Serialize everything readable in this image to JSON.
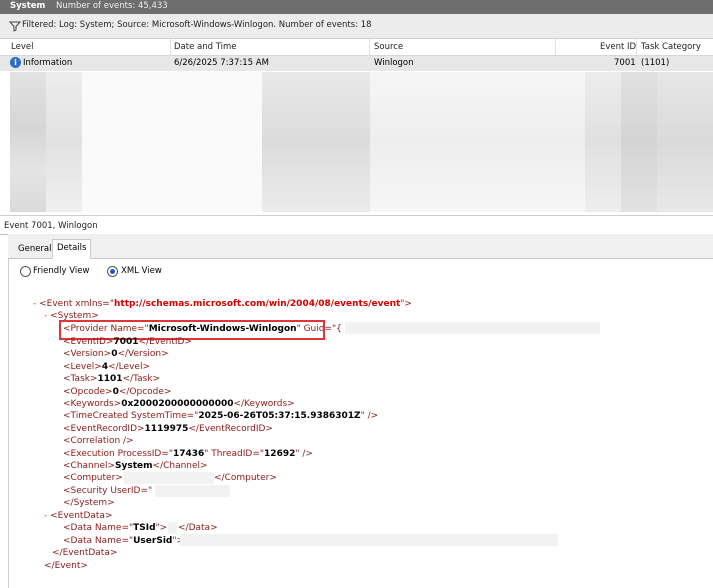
{
  "titlebar": {
    "log_name": "System",
    "event_count": "Number of events: 45,433"
  },
  "filter": {
    "text": "Filtered: Log: System; Source: Microsoft-Windows-Winlogon. Number of events: 18"
  },
  "grid": {
    "columns": [
      "Level",
      "Date and Time",
      "Source",
      "Event ID",
      "Task Category"
    ],
    "selected_row": {
      "level": "Information",
      "datetime": "6/26/2025 7:37:15 AM",
      "source": "Winlogon",
      "event_id": "7001",
      "task_category": "(1101)"
    }
  },
  "event_label": "Event 7001, Winlogon",
  "tabs": [
    "General",
    "Details"
  ],
  "view_options": {
    "friendly": "Friendly View",
    "xml": "XML View",
    "selected": "XML View"
  },
  "xml": {
    "event_open_pre": "<Event xmlns=\"",
    "event_ns": "http://schemas.microsoft.com/win/2004/08/events/event",
    "event_open_post": "\">",
    "system_open": "<System>",
    "provider_pre": "<Provider Name=\"",
    "provider_name": "Microsoft-Windows-Winlogon",
    "provider_post": "\" Guid=\"{",
    "eventid_open": "<EventID>",
    "eventid_val": "7001",
    "eventid_close": "</EventID>",
    "version_open": "<Version>",
    "version_val": "0",
    "version_close": "</Version>",
    "level_open": "<Level>",
    "level_val": "4",
    "level_close": "</Level>",
    "task_open": "<Task>",
    "task_val": "1101",
    "task_close": "</Task>",
    "opcode_open": "<Opcode>",
    "opcode_val": "0",
    "opcode_close": "</Opcode>",
    "keywords_open": "<Keywords>",
    "keywords_val": "0x2000200000000000",
    "keywords_close": "</Keywords>",
    "timecreated_pre": "<TimeCreated SystemTime=\"",
    "timecreated_val": "2025-06-26T05:37:15.9386301Z",
    "timecreated_post": "\" />",
    "recordid_open": "<EventRecordID>",
    "recordid_val": "1119975",
    "recordid_close": "</EventRecordID>",
    "correlation": "<Correlation />",
    "execution_pre": "<Execution ProcessID=\"",
    "execution_pid": "17436",
    "execution_mid": "\" ThreadID=\"",
    "execution_tid": "12692",
    "execution_post": "\" />",
    "channel_open": "<Channel>",
    "channel_val": "System",
    "channel_close": "</Channel>",
    "computer_open": "<Computer>",
    "computer_close": "</Computer>",
    "security_pre": "<Security UserID=\"",
    "system_close": "</System>",
    "eventdata_open": "<EventData>",
    "data1_pre": "<Data Name=\"",
    "data1_name": "TSId",
    "data1_post": "\">",
    "data1_close": "</Data>",
    "data2_pre": "<Data Name=\"",
    "data2_name": "UserSid",
    "data2_post": "\">",
    "eventdata_close": "</EventData>",
    "event_close": "</Event>",
    "minus": "-"
  }
}
